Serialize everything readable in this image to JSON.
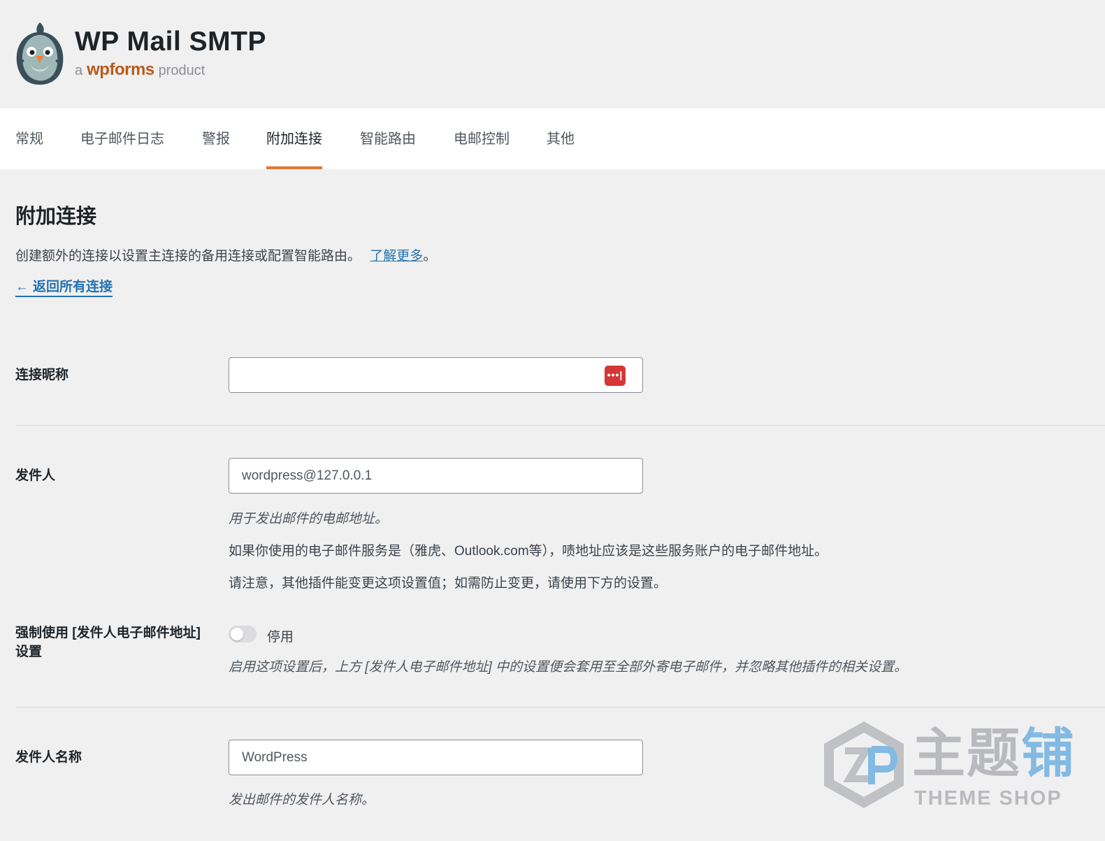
{
  "header": {
    "title": "WP Mail SMTP",
    "subtitle_prefix": "a",
    "subtitle_brand": "wpforms",
    "subtitle_suffix": "product"
  },
  "tabs": [
    {
      "label": "常规",
      "active": false
    },
    {
      "label": "电子邮件日志",
      "active": false
    },
    {
      "label": "警报",
      "active": false
    },
    {
      "label": "附加连接",
      "active": true
    },
    {
      "label": "智能路由",
      "active": false
    },
    {
      "label": "电邮控制",
      "active": false
    },
    {
      "label": "其他",
      "active": false
    }
  ],
  "page": {
    "title": "附加连接",
    "intro": "创建额外的连接以设置主连接的备用连接或配置智能路由。",
    "learn_more": "了解更多",
    "intro_end": "。",
    "back_link": "返回所有连接",
    "back_arrow": "←"
  },
  "fields": {
    "connection_nickname": {
      "label": "连接昵称",
      "value": "",
      "password_manager_icon": "•••|"
    },
    "from_email": {
      "label": "发件人",
      "value": "wordpress@127.0.0.1",
      "desc_1": "用于发出邮件的电邮地址。",
      "desc_2": "如果你使用的电子邮件服务是（雅虎、Outlook.com等），啧地址应该是这些服务账户的电子邮件地址。",
      "desc_3": "请注意，其他插件能变更这项设置值；如需防止变更，请使用下方的设置。"
    },
    "force_from_email": {
      "label": "强制使用 [发件人电子邮件地址] 设置",
      "toggle_state": "停用",
      "enabled": false,
      "desc": "启用这项设置后，上方 [发件人电子邮件地址] 中的设置便会套用至全部外寄电子邮件，并忽略其他插件的相关设置。"
    },
    "from_name": {
      "label": "发件人名称",
      "value": "WordPress",
      "desc": "发出邮件的发件人名称。"
    }
  },
  "watermark": {
    "cn_gray": "主题",
    "cn_blue": "铺",
    "en": "THEME SHOP"
  },
  "colors": {
    "accent": "#e27730",
    "link": "#2271b1",
    "password_icon": "#d63638"
  }
}
